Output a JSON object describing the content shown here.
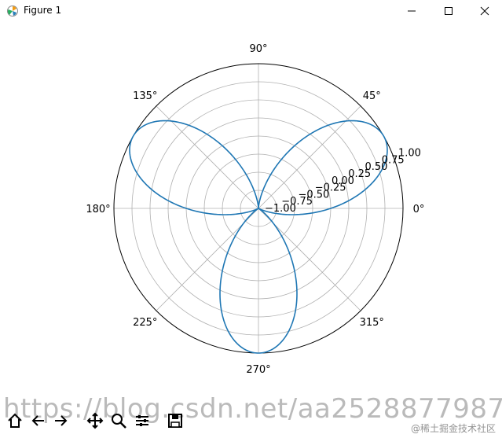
{
  "window": {
    "title": "Figure 1",
    "minimize_icon": "minimize-icon",
    "maximize_icon": "maximize-icon",
    "close_icon": "close-icon"
  },
  "chart_data": {
    "type": "line",
    "projection": "polar",
    "title": "",
    "grid": true,
    "series": [
      {
        "color": "#1f77b4",
        "function": "sin(3*theta)",
        "theta_range_degrees": [
          0,
          360
        ],
        "r_min": -1.0,
        "r_max": 1.0
      }
    ],
    "angle_tick_labels": [
      "0°",
      "45°",
      "90°",
      "135°",
      "180°",
      "225°",
      "270°",
      "315°"
    ],
    "radial_tick_labels": [
      "−1.00",
      "−0.75",
      "−0.50",
      "−0.25",
      "0.00",
      "0.25",
      "0.50",
      "0.75",
      "1.00"
    ],
    "radial_label_angle_degrees": 22.5
  },
  "toolbar": {
    "buttons": [
      "home-icon",
      "back-icon",
      "forward-icon",
      "pan-icon",
      "zoom-icon",
      "configure-icon",
      "save-icon"
    ]
  },
  "watermark": {
    "url_text": "https://blog.csdn.net/aa2528877987",
    "corner_text": "@稀土掘金技术社区"
  }
}
